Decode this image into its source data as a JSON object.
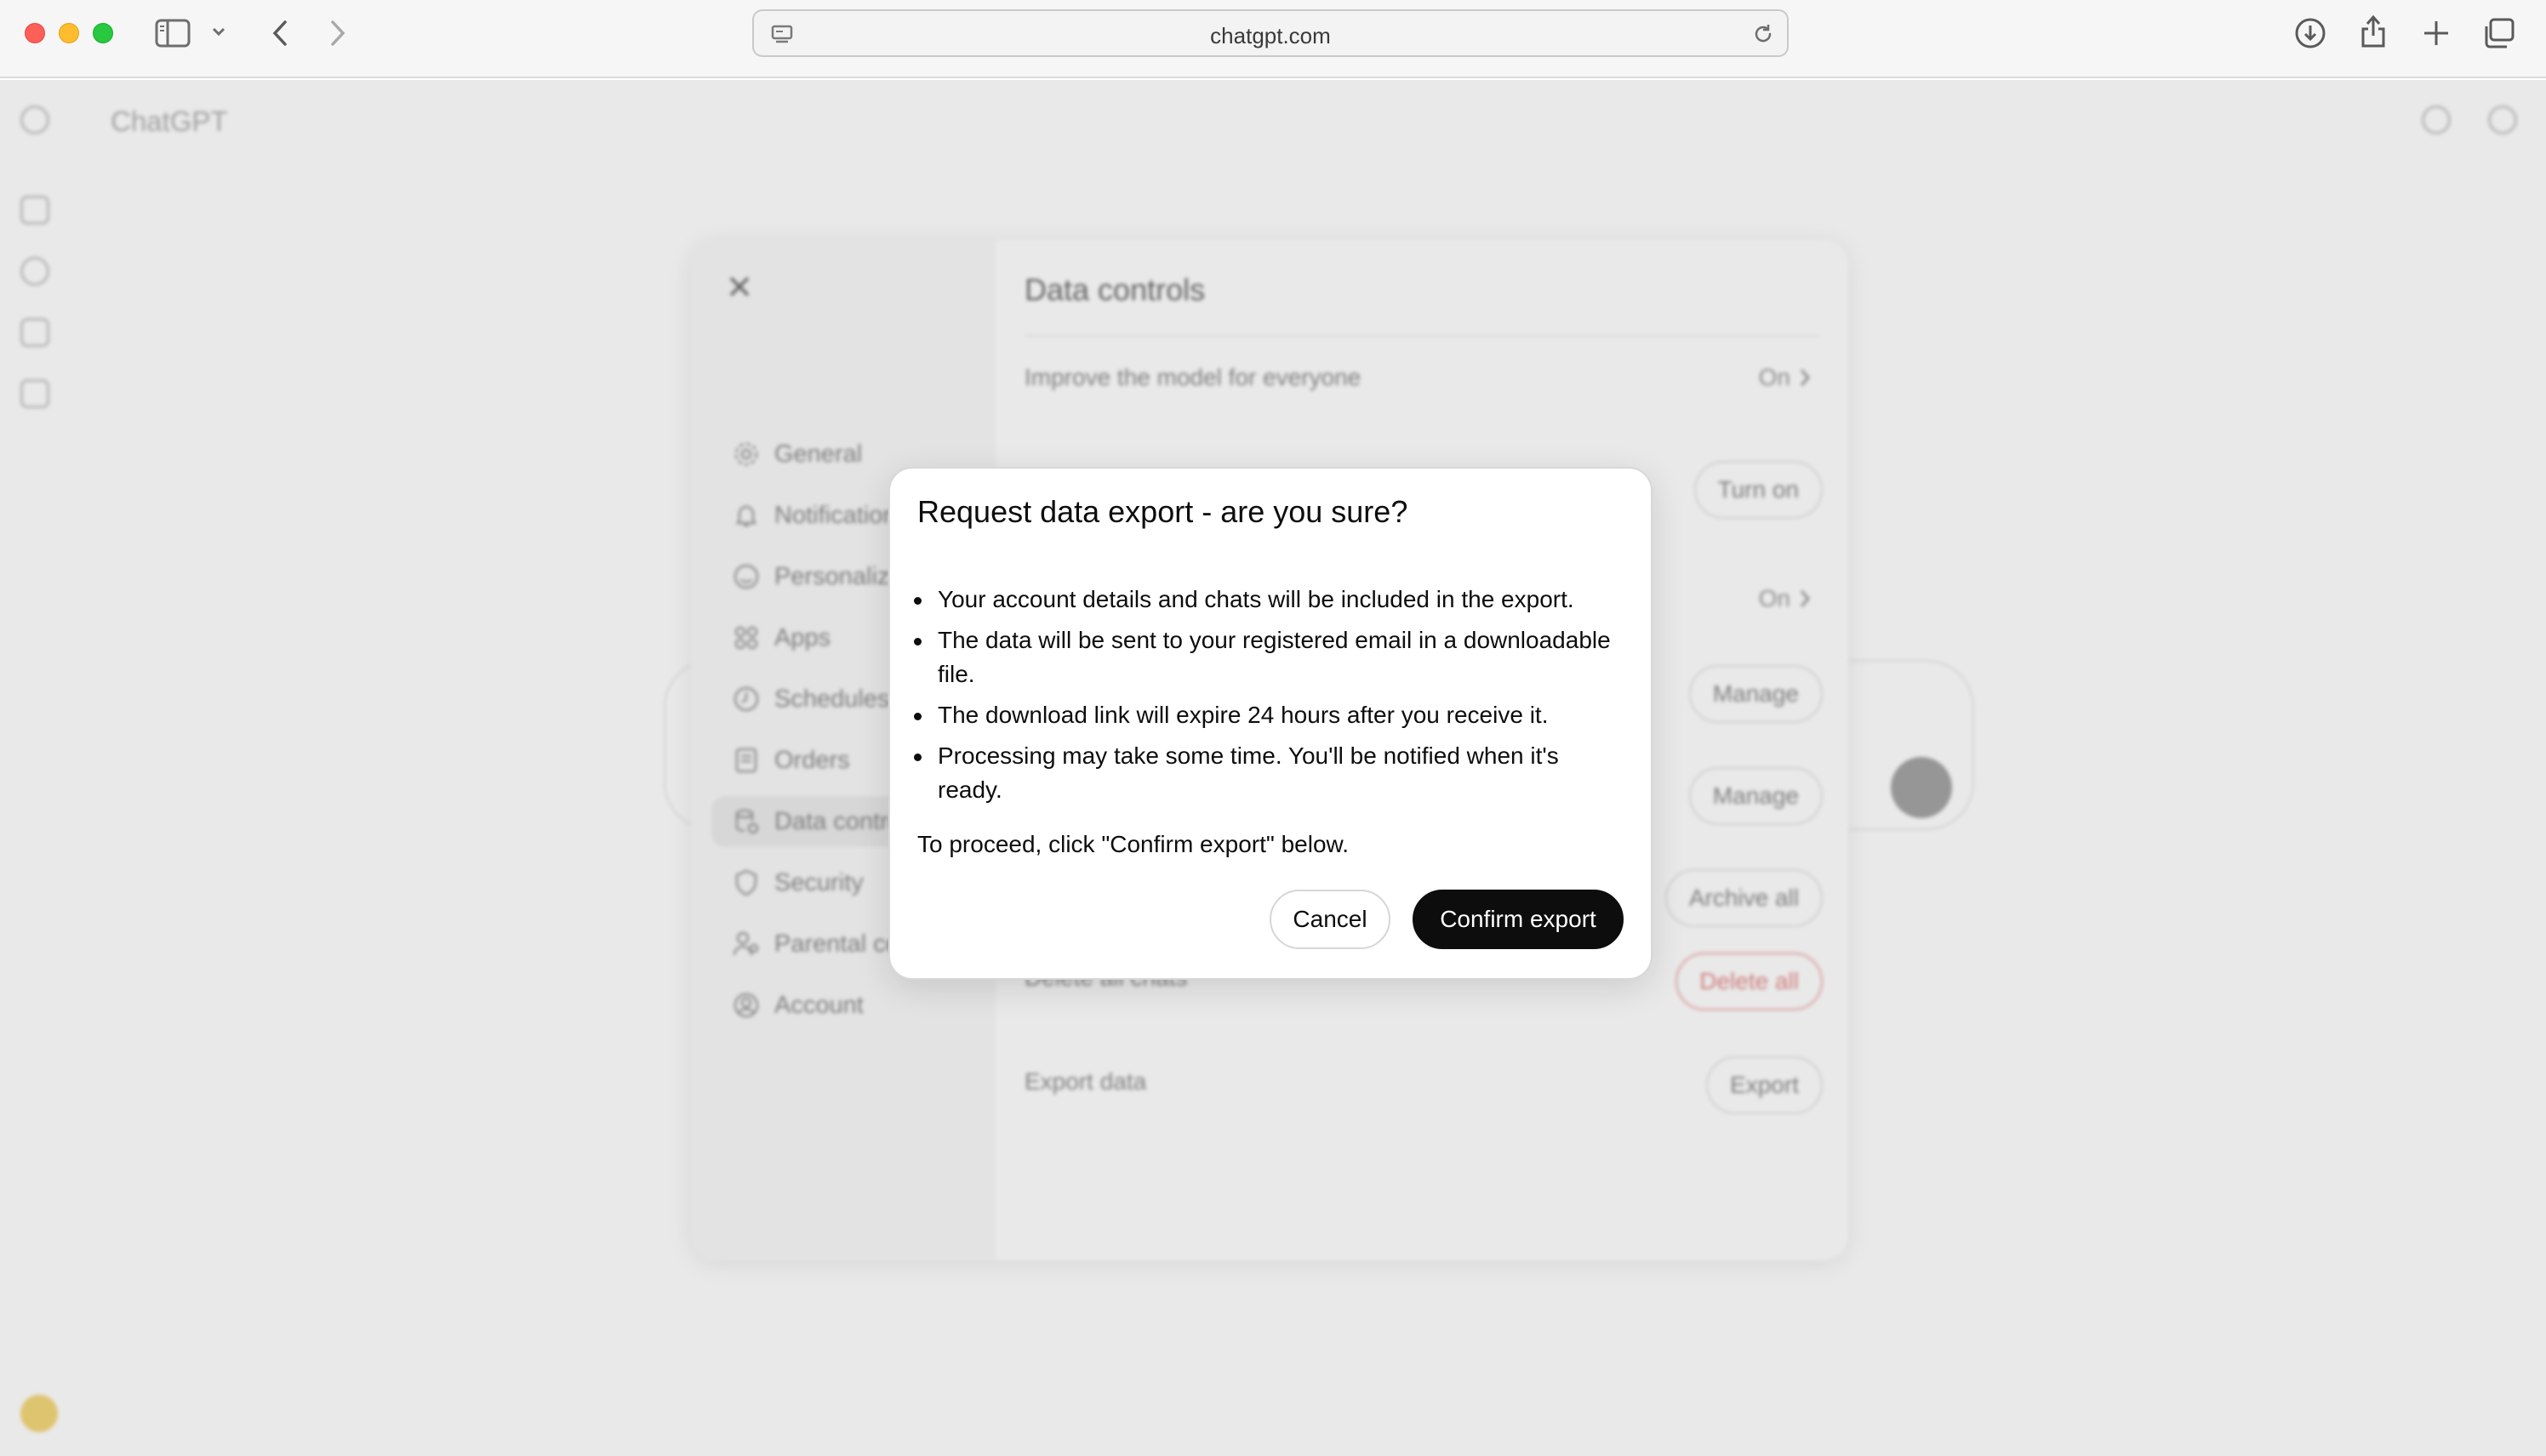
{
  "browser": {
    "url": "chatgpt.com"
  },
  "app": {
    "title": "ChatGPT"
  },
  "settings": {
    "title": "Data controls",
    "nav": [
      {
        "label": "General",
        "icon": "gear-icon"
      },
      {
        "label": "Notifications",
        "icon": "bell-icon"
      },
      {
        "label": "Personaliza",
        "icon": "personalization-icon"
      },
      {
        "label": "Apps",
        "icon": "apps-grid-icon"
      },
      {
        "label": "Schedules",
        "icon": "clock-icon"
      },
      {
        "label": "Orders",
        "icon": "receipt-icon"
      },
      {
        "label": "Data contro",
        "icon": "database-icon",
        "active": true
      },
      {
        "label": "Security",
        "icon": "shield-icon"
      },
      {
        "label": "Parental co",
        "icon": "parental-icon"
      },
      {
        "label": "Account",
        "icon": "account-icon"
      }
    ],
    "rows": {
      "improve_label": "Improve the model for everyone",
      "improve_value": "On",
      "row2_button": "Turn on",
      "row3_value": "On",
      "row4_button": "Manage",
      "row5_button": "Manage",
      "archive_button": "Archive all",
      "delete_label": "Delete all chats",
      "delete_button": "Delete all",
      "export_label": "Export data",
      "export_button": "Export"
    }
  },
  "modal": {
    "title": "Request data export - are you sure?",
    "bullets": [
      "Your account details and chats will be included in the export.",
      "The data will be sent to your registered email in a downloadable file.",
      "The download link will expire 24 hours after you receive it.",
      "Processing may take some time. You'll be notified when it's ready."
    ],
    "proceed_text": "To proceed, click \"Confirm export\" below.",
    "cancel_label": "Cancel",
    "confirm_label": "Confirm export"
  },
  "colors": {
    "primary_button": "#0d0d0d",
    "danger": "#e48a8a"
  }
}
